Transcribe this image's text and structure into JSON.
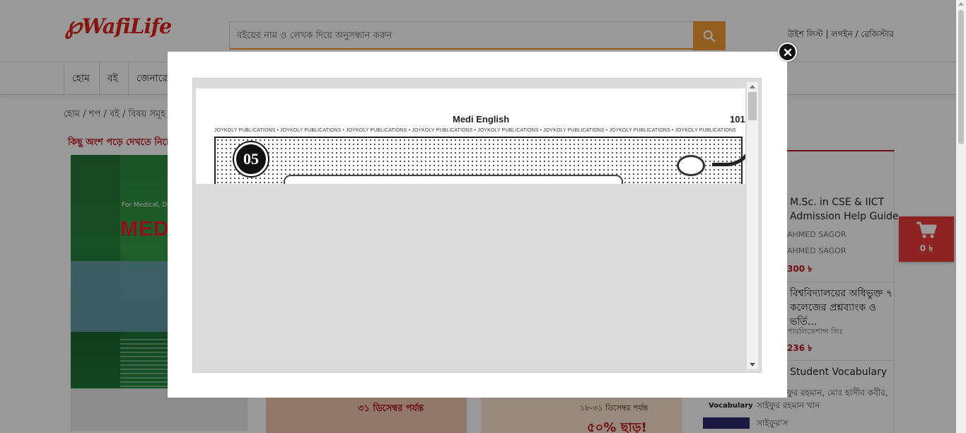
{
  "header": {
    "logo": "WafiLife",
    "search_placeholder": "বইয়ের নাম ও লেখক দিয়ে অনুসন্ধান করুন",
    "top_links": {
      "wishlist": "উইশ লিস্ট",
      "login": "লগইন",
      "register": "রেজিস্টার",
      "sep1": "|",
      "sep2": "/"
    }
  },
  "nav": {
    "items": [
      "হোম",
      "বই",
      "জেনারে"
    ]
  },
  "breadcrumb": "হোম / শপ / বই / বিষয় সমূহ",
  "read_note": "কিছু অংশ পড়ে দেখতে নিচের",
  "book_cover": {
    "title": "MEDI E",
    "subtitle": "For Medical, Dental, A"
  },
  "promos": {
    "p1": "৩১ ডিসেম্বর পর্যন্ত",
    "p2_line": "১৮-৩১ ডিসেম্বর পর্যন্ত",
    "p2_big": "৫০% ছাড়!"
  },
  "sidebar": {
    "item1": {
      "title": "M.Sc. in CSE & IICT Admission Help Guide",
      "meta1": "AHMED SAGOR",
      "meta2": "AHMED SAGOR",
      "price": "300 ৳"
    },
    "item2": {
      "title": "বিশ্ববিদ্যালয়ের অধিভুক্ত ৭ কলেজের প্রশ্নব্যাংক ও ভর্তি...",
      "meta": "পাবলিকেশান্স লিঃ",
      "price": "236 ৳"
    },
    "item3": {
      "title": "Student Vocabulary",
      "thumb1": "Student",
      "thumb2": "Vocabulary",
      "authors": "মোঃ সাইফুর রহমান, মোঃ হাসীব কবীর, সাইফুর রহমান খান",
      "publisher": "সাইফুর'স"
    }
  },
  "cart": {
    "count": "0 ৳"
  },
  "modal": {
    "page_title": "Medi English",
    "page_number": "101",
    "publisher_line": "JOYKOLY PUBLICATIONS • JOYKOLY PUBLICATIONS • JOYKOLY PUBLICATIONS • JOYKOLY PUBLICATIONS • JOYKOLY PUBLICATIONS • JOYKOLY PUBLICATIONS • JOYKOLY PUBLICATIONS • JOYKOLY PUBLICATIONS",
    "chapter": "05"
  },
  "colors": {
    "brand_red": "#e2231a",
    "search_orange": "#f39c34",
    "cart_red": "#ed3b3b"
  }
}
